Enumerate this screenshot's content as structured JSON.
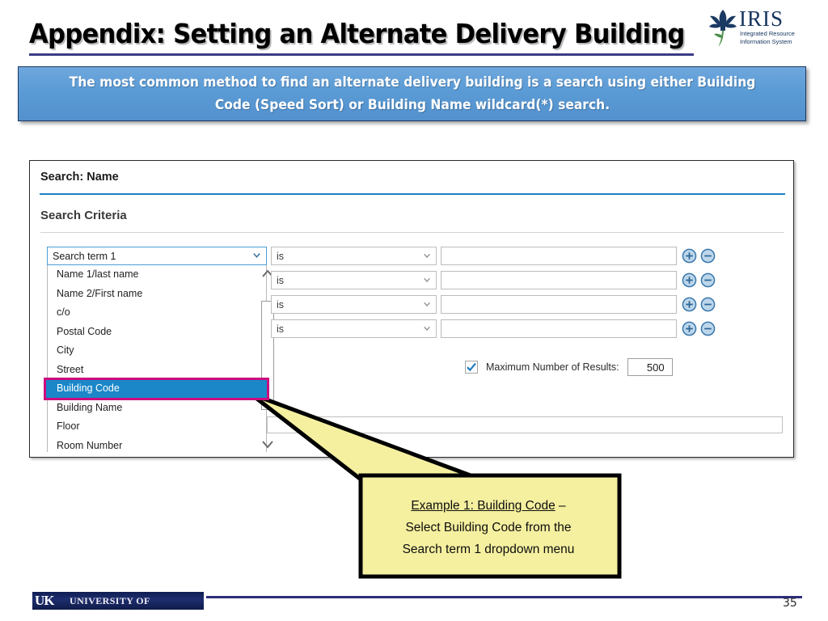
{
  "slide": {
    "title": "Appendix: Setting an Alternate Delivery Building",
    "page_number": "35"
  },
  "logo": {
    "iris_word": "IRIS",
    "iris_subtitle": "Integrated Resource Information System",
    "iris_icon": "iris-flower-icon"
  },
  "banner": {
    "text": "The most common method to find an alternate delivery building is a search using either Building Code (Speed Sort) or Building Name wildcard(*) search.",
    "bg_color": "#5B9BD5",
    "border_color": "#1F3864",
    "text_color": "#FFFFFF"
  },
  "search_panel": {
    "header": "Search: Name",
    "header_rule_color": "#1B7FC4",
    "section_title": "Search Criteria",
    "term_select": {
      "value": "Search term 1",
      "arrow_icon": "chevron-down-icon",
      "focus_border_color": "#4B9FD5"
    },
    "dropdown_options": [
      "Name 1/last name",
      "Name 2/First name",
      "c/o",
      "Postal Code",
      "City",
      "Street",
      "Building Code",
      "Building Name",
      "Floor",
      "Room Number"
    ],
    "selected_option": "Building Code",
    "selected_highlight_color": "#1B87C9",
    "selected_outline_color": "#CC0B7E",
    "scrollbar": {
      "up_icon": "chevron-up-icon",
      "down_icon": "chevron-down-icon",
      "thumb": "scrollbar-thumb"
    },
    "criteria_rows": [
      {
        "operator": "is",
        "value": ""
      },
      {
        "operator": "is",
        "value": ""
      },
      {
        "operator": "is",
        "value": ""
      },
      {
        "operator": "is",
        "value": ""
      }
    ],
    "row_add_icon": "plus-circle-icon",
    "row_remove_icon": "minus-circle-icon",
    "max_results": {
      "checked": true,
      "label": "Maximum Number of Results:",
      "value": "500",
      "check_icon": "checkmark-icon"
    },
    "bottom_input": {
      "value": ""
    }
  },
  "callout": {
    "line1_underlined": "Example 1: Building Code",
    "line1_tail": " –",
    "line2": "Select Building Code from the",
    "line3": "Search term 1 dropdown menu",
    "fill_color": "#F5F0A0",
    "border_color": "#000000"
  },
  "footer": {
    "uk_mark": "UK",
    "uk_name": "UNIVERSITY OF KENTUCKY",
    "rule_color": "#2E2E7A"
  }
}
